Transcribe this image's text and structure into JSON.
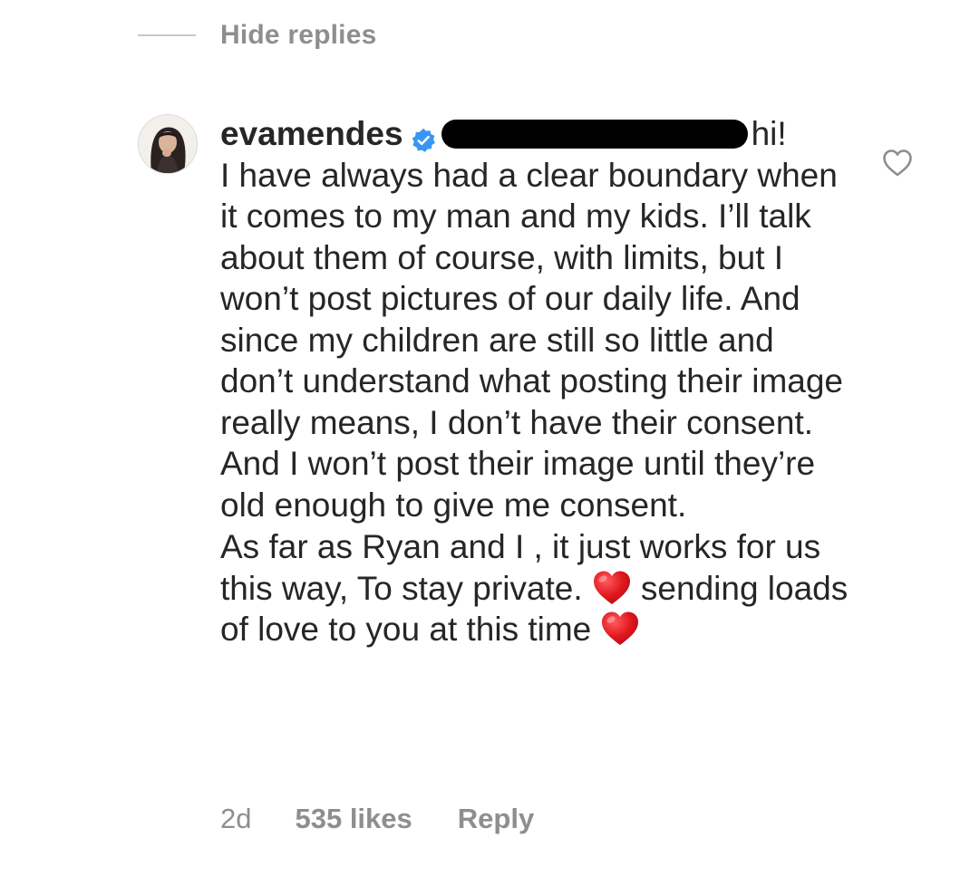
{
  "thread": {
    "hide_replies_label": "Hide replies"
  },
  "comment": {
    "username": "evamendes",
    "verified_icon": "verified-badge-icon",
    "mention_redacted": true,
    "greeting": "hi!",
    "paragraph_1": "I have always had a clear boundary when it comes to my man and my kids. I’ll talk about them of course, with limits, but I won’t post pictures of our daily life. And since my children are still so little and don’t understand what posting their image really means, I don’t have their consent. And I won’t post their image until they’re old enough to give me consent.",
    "paragraph_2_part_1": "As far as Ryan and I , it just works for us this way, To stay private.",
    "paragraph_2_part_2": "sending loads of love to you at this time",
    "emoji": "red-heart-emoji",
    "like_icon": "heart-outline-icon"
  },
  "meta": {
    "time": "2d",
    "likes": "535 likes",
    "reply_label": "Reply"
  },
  "colors": {
    "text": "#262626",
    "secondary": "#8e8e8e",
    "verified_blue": "#3897f0",
    "heart_red": "#e0181f",
    "redaction": "#000000"
  }
}
